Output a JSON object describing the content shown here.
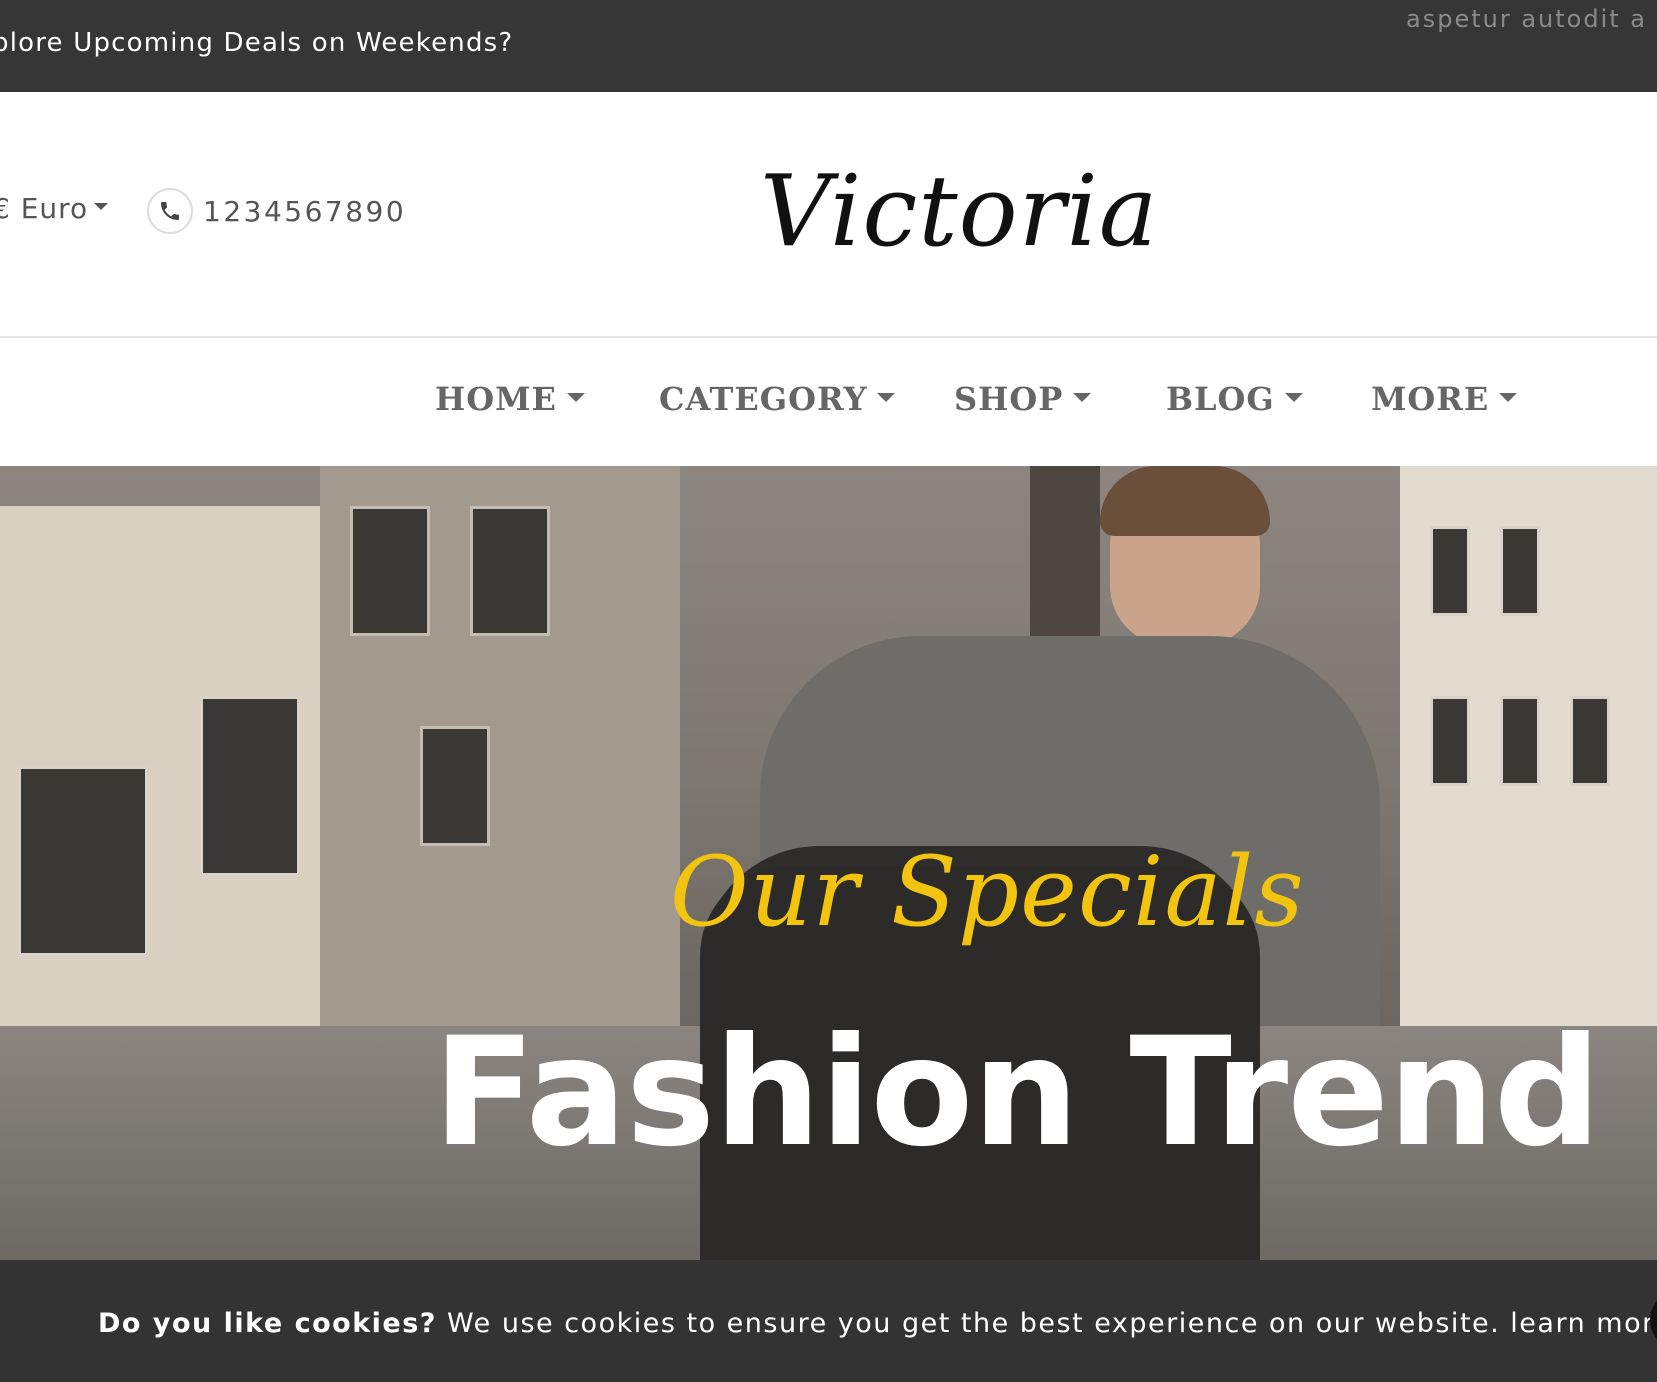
{
  "topbar": {
    "promo": "plore Upcoming Deals on Weekends?",
    "marquee": "aspetur autodit a"
  },
  "header": {
    "currency": "€ Euro",
    "phone": "1234567890",
    "logo": "Victoria"
  },
  "nav": {
    "items": [
      {
        "label": "HOME"
      },
      {
        "label": "CATEGORY"
      },
      {
        "label": "SHOP"
      },
      {
        "label": "BLOG"
      },
      {
        "label": "MORE"
      }
    ]
  },
  "hero": {
    "subtitle": "Our Specials",
    "title": "Fashion Trend"
  },
  "cookie": {
    "bold": "Do you like cookies?",
    "text": " We use cookies to ensure you get the best experience on our website.",
    "link": " learn more"
  },
  "colors": {
    "topbar_bg": "#363636",
    "accent_yellow": "#f2c40f",
    "cookie_bg": "#333333"
  }
}
